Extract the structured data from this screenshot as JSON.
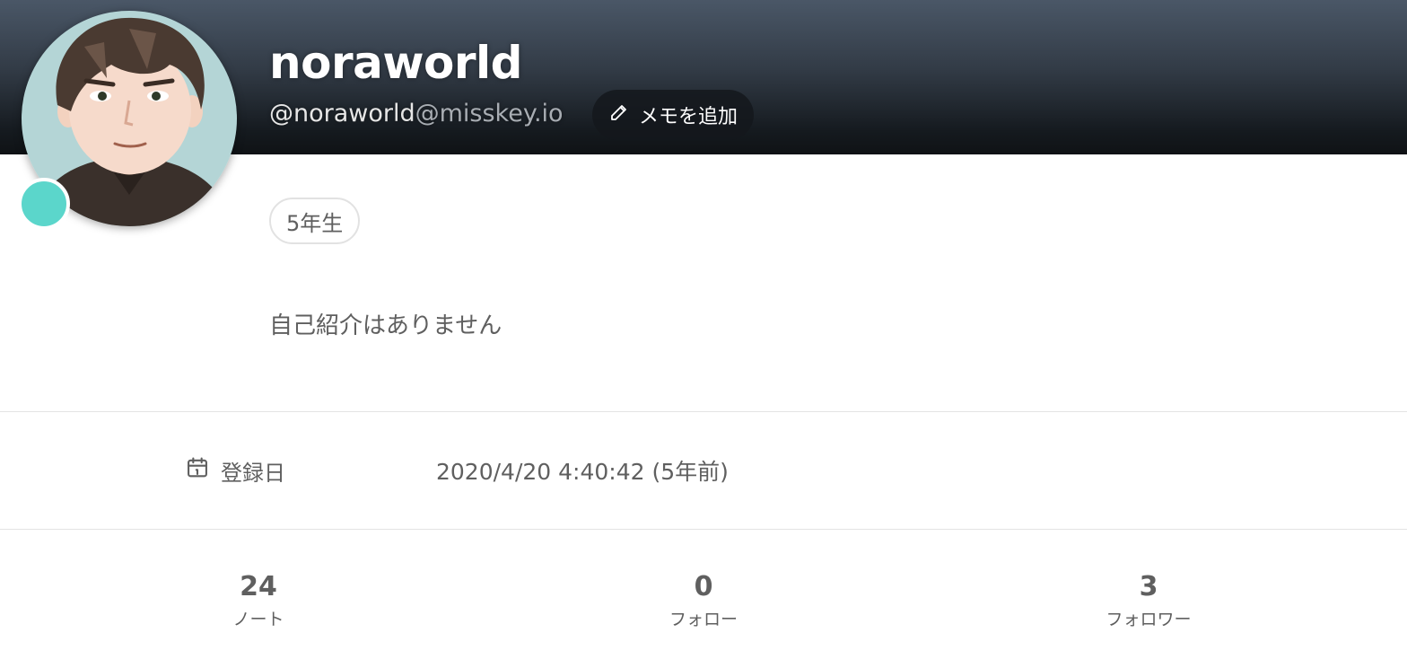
{
  "profile": {
    "display_name": "noraworld",
    "username": "@noraworld",
    "host": "@misskey.io",
    "memo_button_label": "メモを追加",
    "badge": "5年生",
    "bio": "自己紹介はありません",
    "online_status_color": "#5bd6cb"
  },
  "fields": {
    "joined_label": "登録日",
    "joined_value": "2020/4/20 4:40:42 (5年前)"
  },
  "stats": [
    {
      "value": "24",
      "label": "ノート"
    },
    {
      "value": "0",
      "label": "フォロー"
    },
    {
      "value": "3",
      "label": "フォロワー"
    }
  ],
  "icons": {
    "memo": "pencil-icon",
    "joined": "calendar-icon"
  }
}
